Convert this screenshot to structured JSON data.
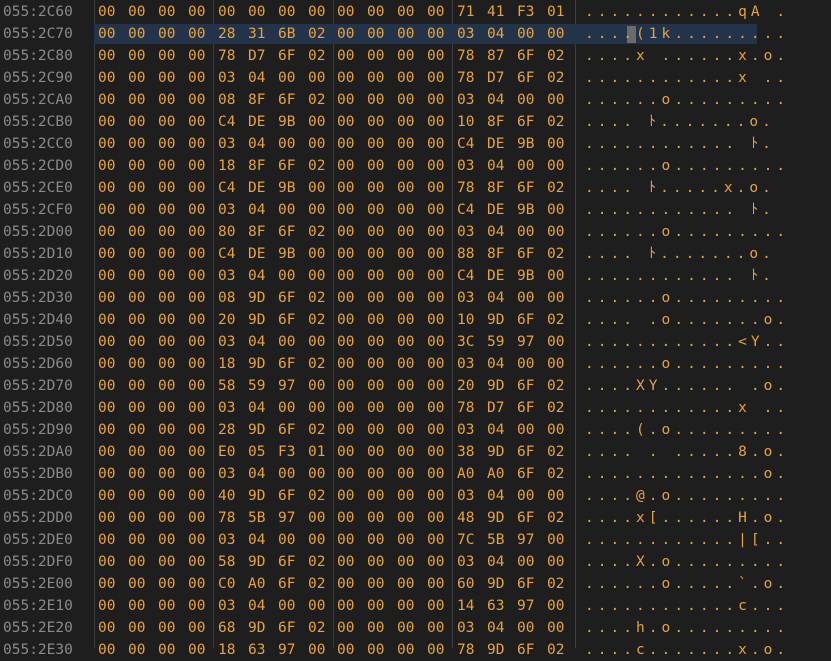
{
  "hexview": {
    "selected_row": 1,
    "cursor_col": 3,
    "rows": [
      {
        "addr": "055:2C60",
        "bytes": [
          "00",
          "00",
          "00",
          "00",
          "00",
          "00",
          "00",
          "00",
          "00",
          "00",
          "00",
          "00",
          "71",
          "41",
          "F3",
          "01"
        ],
        "ascii": "............qA ."
      },
      {
        "addr": "055:2C70",
        "bytes": [
          "00",
          "00",
          "00",
          "00",
          "28",
          "31",
          "6B",
          "02",
          "00",
          "00",
          "00",
          "00",
          "03",
          "04",
          "00",
          "00"
        ],
        "ascii": "....(1k........."
      },
      {
        "addr": "055:2C80",
        "bytes": [
          "00",
          "00",
          "00",
          "00",
          "78",
          "D7",
          "6F",
          "02",
          "00",
          "00",
          "00",
          "00",
          "78",
          "87",
          "6F",
          "02"
        ],
        "ascii": "....x ......x.o."
      },
      {
        "addr": "055:2C90",
        "bytes": [
          "00",
          "00",
          "00",
          "00",
          "03",
          "04",
          "00",
          "00",
          "00",
          "00",
          "00",
          "00",
          "78",
          "D7",
          "6F",
          "02"
        ],
        "ascii": "............x .."
      },
      {
        "addr": "055:2CA0",
        "bytes": [
          "00",
          "00",
          "00",
          "00",
          "08",
          "8F",
          "6F",
          "02",
          "00",
          "00",
          "00",
          "00",
          "03",
          "04",
          "00",
          "00"
        ],
        "ascii": "......o........."
      },
      {
        "addr": "055:2CB0",
        "bytes": [
          "00",
          "00",
          "00",
          "00",
          "C4",
          "DE",
          "9B",
          "00",
          "00",
          "00",
          "00",
          "00",
          "10",
          "8F",
          "6F",
          "02"
        ],
        "ascii": "....  ﾄ.......o."
      },
      {
        "addr": "055:2CC0",
        "bytes": [
          "00",
          "00",
          "00",
          "00",
          "03",
          "04",
          "00",
          "00",
          "00",
          "00",
          "00",
          "00",
          "C4",
          "DE",
          "9B",
          "00"
        ],
        "ascii": "............  ﾄ."
      },
      {
        "addr": "055:2CD0",
        "bytes": [
          "00",
          "00",
          "00",
          "00",
          "18",
          "8F",
          "6F",
          "02",
          "00",
          "00",
          "00",
          "00",
          "03",
          "04",
          "00",
          "00"
        ],
        "ascii": "......o........."
      },
      {
        "addr": "055:2CE0",
        "bytes": [
          "00",
          "00",
          "00",
          "00",
          "C4",
          "DE",
          "9B",
          "00",
          "00",
          "00",
          "00",
          "00",
          "78",
          "8F",
          "6F",
          "02"
        ],
        "ascii": "....  ﾄ.....x.o."
      },
      {
        "addr": "055:2CF0",
        "bytes": [
          "00",
          "00",
          "00",
          "00",
          "03",
          "04",
          "00",
          "00",
          "00",
          "00",
          "00",
          "00",
          "C4",
          "DE",
          "9B",
          "00"
        ],
        "ascii": "............  ﾄ."
      },
      {
        "addr": "055:2D00",
        "bytes": [
          "00",
          "00",
          "00",
          "00",
          "80",
          "8F",
          "6F",
          "02",
          "00",
          "00",
          "00",
          "00",
          "03",
          "04",
          "00",
          "00"
        ],
        "ascii": "......o........."
      },
      {
        "addr": "055:2D10",
        "bytes": [
          "00",
          "00",
          "00",
          "00",
          "C4",
          "DE",
          "9B",
          "00",
          "00",
          "00",
          "00",
          "00",
          "88",
          "8F",
          "6F",
          "02"
        ],
        "ascii": "....  ﾄ.......o."
      },
      {
        "addr": "055:2D20",
        "bytes": [
          "00",
          "00",
          "00",
          "00",
          "03",
          "04",
          "00",
          "00",
          "00",
          "00",
          "00",
          "00",
          "C4",
          "DE",
          "9B",
          "00"
        ],
        "ascii": "............  ﾄ."
      },
      {
        "addr": "055:2D30",
        "bytes": [
          "00",
          "00",
          "00",
          "00",
          "08",
          "9D",
          "6F",
          "02",
          "00",
          "00",
          "00",
          "00",
          "03",
          "04",
          "00",
          "00"
        ],
        "ascii": "......o........."
      },
      {
        "addr": "055:2D40",
        "bytes": [
          "00",
          "00",
          "00",
          "00",
          "20",
          "9D",
          "6F",
          "02",
          "00",
          "00",
          "00",
          "00",
          "10",
          "9D",
          "6F",
          "02"
        ],
        "ascii": ".... .o.......o."
      },
      {
        "addr": "055:2D50",
        "bytes": [
          "00",
          "00",
          "00",
          "00",
          "03",
          "04",
          "00",
          "00",
          "00",
          "00",
          "00",
          "00",
          "3C",
          "59",
          "97",
          "00"
        ],
        "ascii": "............<Y.."
      },
      {
        "addr": "055:2D60",
        "bytes": [
          "00",
          "00",
          "00",
          "00",
          "18",
          "9D",
          "6F",
          "02",
          "00",
          "00",
          "00",
          "00",
          "03",
          "04",
          "00",
          "00"
        ],
        "ascii": "......o........."
      },
      {
        "addr": "055:2D70",
        "bytes": [
          "00",
          "00",
          "00",
          "00",
          "58",
          "59",
          "97",
          "00",
          "00",
          "00",
          "00",
          "00",
          "20",
          "9D",
          "6F",
          "02"
        ],
        "ascii": "....XY...... .o."
      },
      {
        "addr": "055:2D80",
        "bytes": [
          "00",
          "00",
          "00",
          "00",
          "03",
          "04",
          "00",
          "00",
          "00",
          "00",
          "00",
          "00",
          "78",
          "D7",
          "6F",
          "02"
        ],
        "ascii": "............x .."
      },
      {
        "addr": "055:2D90",
        "bytes": [
          "00",
          "00",
          "00",
          "00",
          "28",
          "9D",
          "6F",
          "02",
          "00",
          "00",
          "00",
          "00",
          "03",
          "04",
          "00",
          "00"
        ],
        "ascii": "....(.o........."
      },
      {
        "addr": "055:2DA0",
        "bytes": [
          "00",
          "00",
          "00",
          "00",
          "E0",
          "05",
          "F3",
          "01",
          "00",
          "00",
          "00",
          "00",
          "38",
          "9D",
          "6F",
          "02"
        ],
        "ascii": ".... . .....8.o."
      },
      {
        "addr": "055:2DB0",
        "bytes": [
          "00",
          "00",
          "00",
          "00",
          "03",
          "04",
          "00",
          "00",
          "00",
          "00",
          "00",
          "00",
          "A0",
          "A0",
          "6F",
          "02"
        ],
        "ascii": "..............o."
      },
      {
        "addr": "055:2DC0",
        "bytes": [
          "00",
          "00",
          "00",
          "00",
          "40",
          "9D",
          "6F",
          "02",
          "00",
          "00",
          "00",
          "00",
          "03",
          "04",
          "00",
          "00"
        ],
        "ascii": "....@.o........."
      },
      {
        "addr": "055:2DD0",
        "bytes": [
          "00",
          "00",
          "00",
          "00",
          "78",
          "5B",
          "97",
          "00",
          "00",
          "00",
          "00",
          "00",
          "48",
          "9D",
          "6F",
          "02"
        ],
        "ascii": "....x[......H.o."
      },
      {
        "addr": "055:2DE0",
        "bytes": [
          "00",
          "00",
          "00",
          "00",
          "03",
          "04",
          "00",
          "00",
          "00",
          "00",
          "00",
          "00",
          "7C",
          "5B",
          "97",
          "00"
        ],
        "ascii": "............|[.."
      },
      {
        "addr": "055:2DF0",
        "bytes": [
          "00",
          "00",
          "00",
          "00",
          "58",
          "9D",
          "6F",
          "02",
          "00",
          "00",
          "00",
          "00",
          "03",
          "04",
          "00",
          "00"
        ],
        "ascii": "....X.o........."
      },
      {
        "addr": "055:2E00",
        "bytes": [
          "00",
          "00",
          "00",
          "00",
          "C0",
          "A0",
          "6F",
          "02",
          "00",
          "00",
          "00",
          "00",
          "60",
          "9D",
          "6F",
          "02"
        ],
        "ascii": "......o.....`.o."
      },
      {
        "addr": "055:2E10",
        "bytes": [
          "00",
          "00",
          "00",
          "00",
          "03",
          "04",
          "00",
          "00",
          "00",
          "00",
          "00",
          "00",
          "14",
          "63",
          "97",
          "00"
        ],
        "ascii": "............c..."
      },
      {
        "addr": "055:2E20",
        "bytes": [
          "00",
          "00",
          "00",
          "00",
          "68",
          "9D",
          "6F",
          "02",
          "00",
          "00",
          "00",
          "00",
          "03",
          "04",
          "00",
          "00"
        ],
        "ascii": "....h.o........."
      },
      {
        "addr": "055:2E30",
        "bytes": [
          "00",
          "00",
          "00",
          "00",
          "18",
          "63",
          "97",
          "00",
          "00",
          "00",
          "00",
          "00",
          "78",
          "9D",
          "6F",
          "02"
        ],
        "ascii": "....c.......x.o."
      }
    ]
  }
}
